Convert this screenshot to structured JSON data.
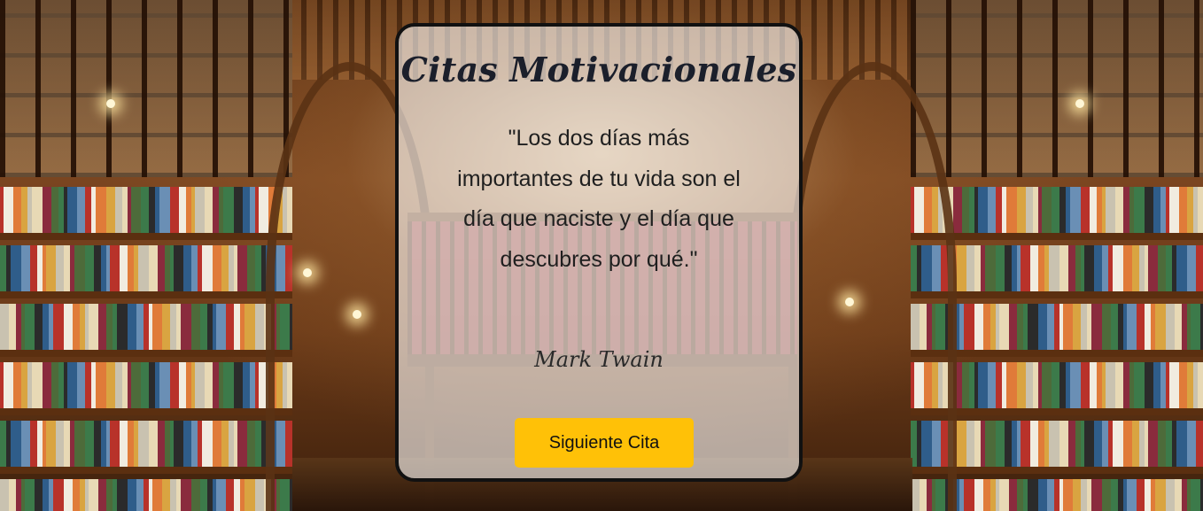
{
  "card": {
    "title": "Citas Motivacionales",
    "quote": "\"Los dos días más importantes de tu vida son el día que naciste y el día que descubres por qué.\"",
    "author": "Mark Twain",
    "next_button_label": "Siguiente Cita"
  },
  "colors": {
    "button_background": "#ffc107",
    "card_border": "#111111",
    "title_color": "#1b1f2b"
  }
}
